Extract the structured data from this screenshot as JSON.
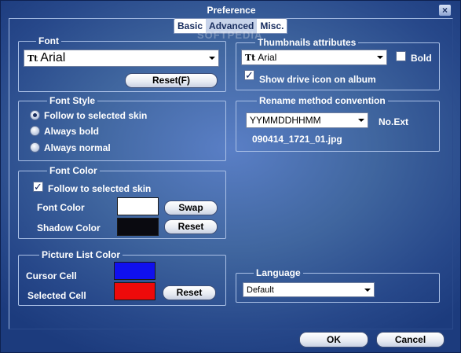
{
  "window": {
    "title": "Preference",
    "close_glyph": "×"
  },
  "tabs": [
    {
      "label": "Basic",
      "active": false
    },
    {
      "label": "Advanced",
      "active": true
    },
    {
      "label": "Misc.",
      "active": false
    }
  ],
  "watermark": "SOFTPEDIA",
  "font": {
    "title": "Font",
    "select_value": "Arial",
    "font_icon": "Tt",
    "reset_label": "Reset(F)"
  },
  "font_style": {
    "title": "Font Style",
    "options": [
      {
        "label": "Follow to selected skin",
        "checked": true
      },
      {
        "label": "Always bold",
        "checked": false
      },
      {
        "label": "Always normal",
        "checked": false
      }
    ]
  },
  "font_color": {
    "title": "Font Color",
    "follow_label": "Follow to selected skin",
    "follow_checked": true,
    "font_color_label": "Font Color",
    "font_color_value": "#ffffff",
    "shadow_color_label": "Shadow Color",
    "shadow_color_value": "#0a0a10",
    "swap_label": "Swap",
    "reset_label": "Reset"
  },
  "picture_list": {
    "title": "Picture List Color",
    "cursor_label": "Cursor Cell",
    "cursor_color": "#1010ee",
    "selected_label": "Selected Cell",
    "selected_color": "#ee0a0a",
    "reset_label": "Reset"
  },
  "thumbnails": {
    "title": "Thumbnails attributes",
    "font_value": "Arial",
    "font_icon": "Tt",
    "bold_label": "Bold",
    "bold_checked": false,
    "show_drive_label": "Show drive icon on album",
    "show_drive_checked": true
  },
  "rename": {
    "title": "Rename method convention",
    "format_value": "YYMMDDHHMM",
    "ext_label": "No.Ext",
    "example": "090414_1721_01.jpg"
  },
  "language": {
    "title": "Language",
    "value": "Default"
  },
  "footer": {
    "ok_label": "OK",
    "cancel_label": "Cancel"
  }
}
